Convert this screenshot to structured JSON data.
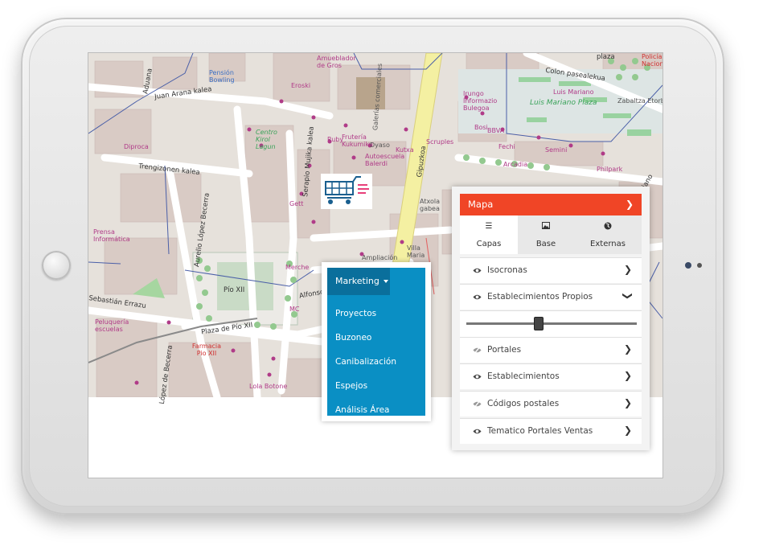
{
  "map": {
    "streets": [
      "Juan Arana kalea",
      "Aduana",
      "Trengizonen kalea",
      "Aurelio López Becerra",
      "Serapio Mujika kalea",
      "Gipuzkoa",
      "Colon pasealekua",
      "Luis Mariano",
      "Luis Mariano Plaza",
      "Alfonso",
      "Plaza de Pío XII",
      "Sebastián Errazu",
      "López de Becerra",
      "Pío XII",
      "Zabaltza Etorbidea",
      "Luis Mariano",
      "plaza"
    ],
    "pois": [
      "Amueblador de Gros",
      "Pensión Bowling",
      "Eroski",
      "Galerías comerciales",
      "Centro Kirol Lagun",
      "Ruby",
      "Frutería Kukumiku",
      "Dyaso",
      "Kutxa",
      "Autoescuela Balerdi",
      "Diproca",
      "Prensa Informática",
      "Gett",
      "Atxola gabea",
      "Villa Maria",
      "Merche",
      "MC",
      "Ampliación",
      "Farmacia Pio XII",
      "Peluquería escuelas",
      "Lola Botone",
      "Scruples",
      "Irungo Informazio Bulegoa",
      "BBVA",
      "Bosi",
      "Arcadia",
      "Fechi",
      "Philpark",
      "Policía Nacional",
      "Semini",
      "Luis Mariano"
    ],
    "cart_icon": "shopping-cart-icon"
  },
  "marketing": {
    "title": "Marketing",
    "items": [
      "Proyectos",
      "Buzoneo",
      "Canibalización",
      "Espejos",
      "Análisis Área"
    ]
  },
  "panel": {
    "title": "Mapa",
    "tabs": [
      {
        "label": "Capas",
        "icon": "list-icon"
      },
      {
        "label": "Base",
        "icon": "image-icon"
      },
      {
        "label": "Externas",
        "icon": "globe-icon"
      }
    ],
    "layers": [
      {
        "label": "Isocronas",
        "visible": true,
        "expanded": false
      },
      {
        "label": "Establecimientos Propios",
        "visible": true,
        "expanded": true
      },
      {
        "label": "Portales",
        "visible": false,
        "expanded": false
      },
      {
        "label": "Establecimientos",
        "visible": true,
        "expanded": false
      },
      {
        "label": "Códigos postales",
        "visible": false,
        "expanded": false
      },
      {
        "label": "Tematico Portales Ventas",
        "visible": true,
        "expanded": false
      }
    ],
    "opacity": 0.42
  },
  "colors": {
    "accent": "#f04526",
    "menu": "#0a8fc4",
    "menu_dark": "#0a6f9c"
  }
}
